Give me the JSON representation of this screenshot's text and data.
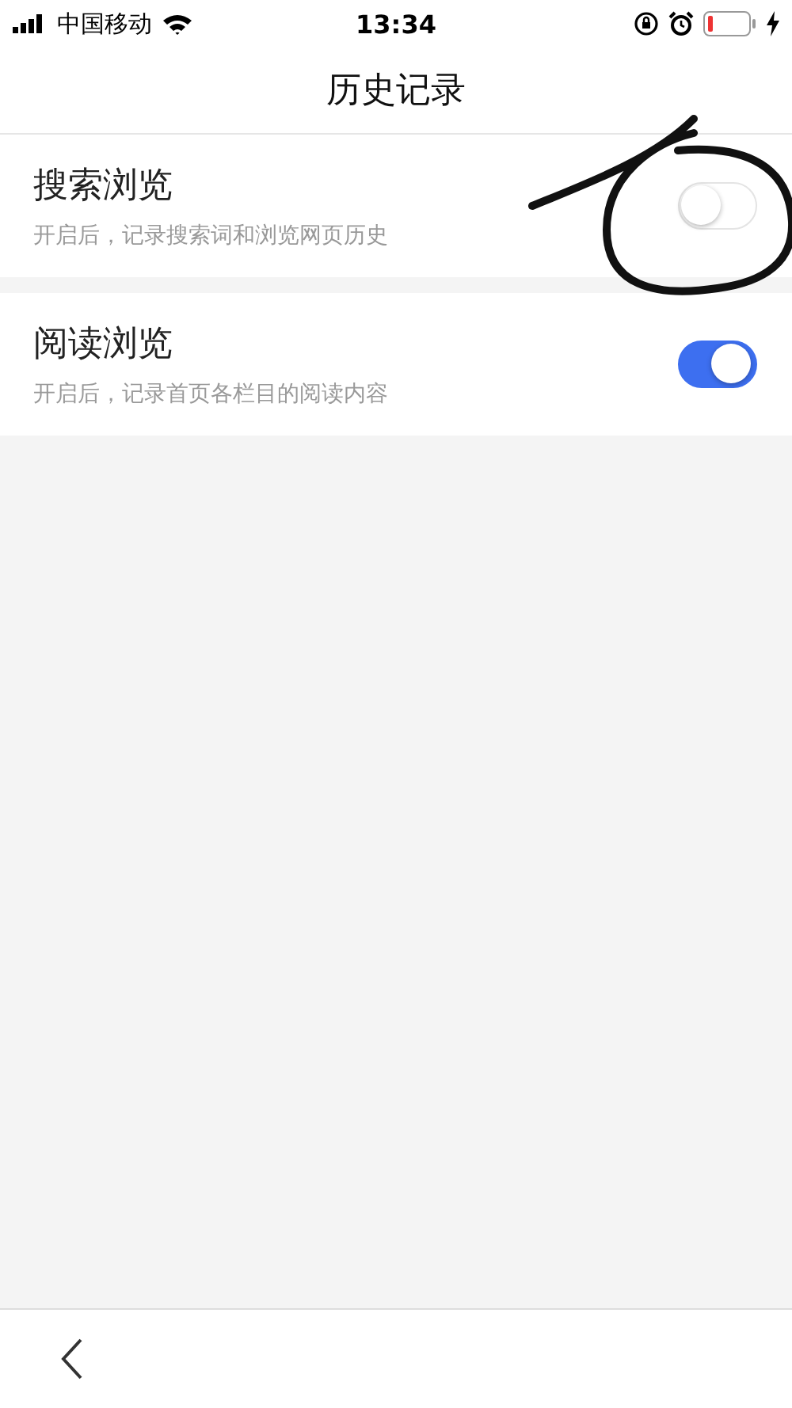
{
  "status_bar": {
    "carrier": "中国移动",
    "time": "13:34"
  },
  "title": "历史记录",
  "settings": [
    {
      "label": "搜索浏览",
      "description": "开启后，记录搜索词和浏览网页历史",
      "on": false
    },
    {
      "label": "阅读浏览",
      "description": "开启后，记录首页各栏目的阅读内容",
      "on": true
    }
  ]
}
